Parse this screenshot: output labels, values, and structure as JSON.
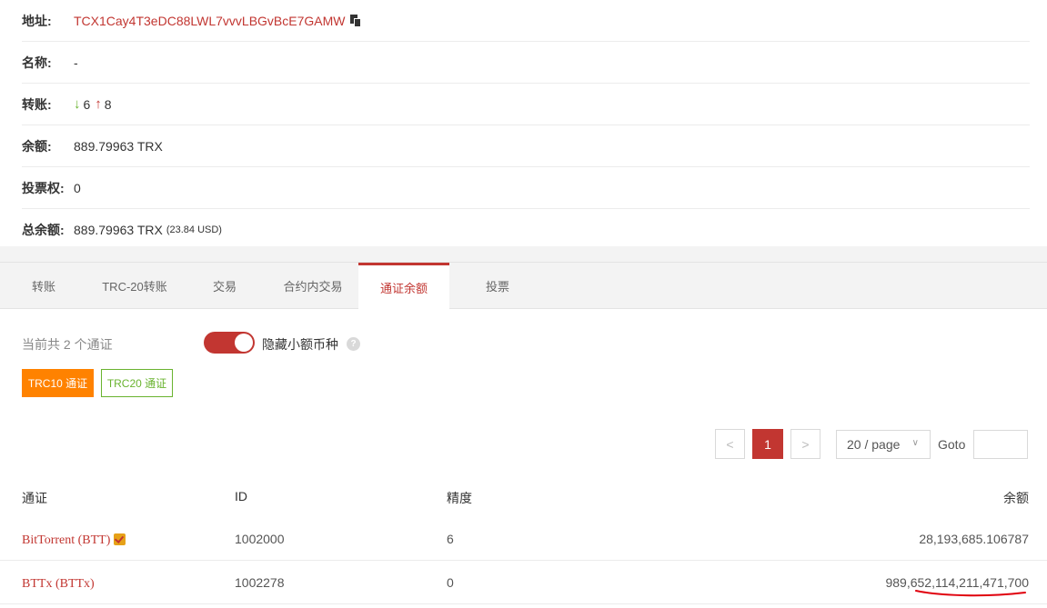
{
  "info": {
    "address_label": "地址:",
    "address_value": "TCX1Cay4T3eDC88LWL7vvvLBGvBcE7GAMW",
    "name_label": "名称:",
    "name_value": "-",
    "transfers_label": "转账:",
    "transfers_in": "6",
    "transfers_out": "8",
    "balance_label": "余额:",
    "balance_value": "889.79963 TRX",
    "vote_label": "投票权:",
    "vote_value": "0",
    "total_label": "总余额:",
    "total_value": "889.79963 TRX",
    "total_usd": "(23.84 USD)"
  },
  "tabs": [
    {
      "label": "转账"
    },
    {
      "label": "TRC-20转账"
    },
    {
      "label": "交易"
    },
    {
      "label": "合约内交易"
    },
    {
      "label": "通证余额",
      "active": true
    },
    {
      "label": "投票"
    }
  ],
  "tokens_panel": {
    "count_text": "当前共 2 个通证",
    "hide_small_label": "隐藏小额币种",
    "hide_small_on": true,
    "help_glyph": "?",
    "trc10_button": "TRC10 通证",
    "trc20_button": "TRC20 通证"
  },
  "pagination": {
    "prev": "<",
    "current_page": "1",
    "next": ">",
    "page_size": "20 / page",
    "goto_label": "Goto",
    "goto_value": ""
  },
  "table": {
    "headers": {
      "token": "通证",
      "id": "ID",
      "precision": "精度",
      "balance": "余额"
    },
    "rows": [
      {
        "token": "BitTorrent (BTT)",
        "verified": true,
        "id": "1002000",
        "precision": "6",
        "balance": "28,193,685.106787"
      },
      {
        "token": "BTTx (BTTx)",
        "verified": false,
        "id": "1002278",
        "precision": "0",
        "balance": "989,652,114,211,471,700"
      }
    ]
  },
  "colors": {
    "accent_red": "#c23631",
    "orange": "#ff8200",
    "green": "#69b32f"
  },
  "icons": {
    "copy": "copy-icon",
    "in": "arrow-down-icon",
    "out": "arrow-up-icon",
    "verified": "verified-badge-icon",
    "help": "question-icon",
    "dropdown": "chevron-down-icon"
  }
}
